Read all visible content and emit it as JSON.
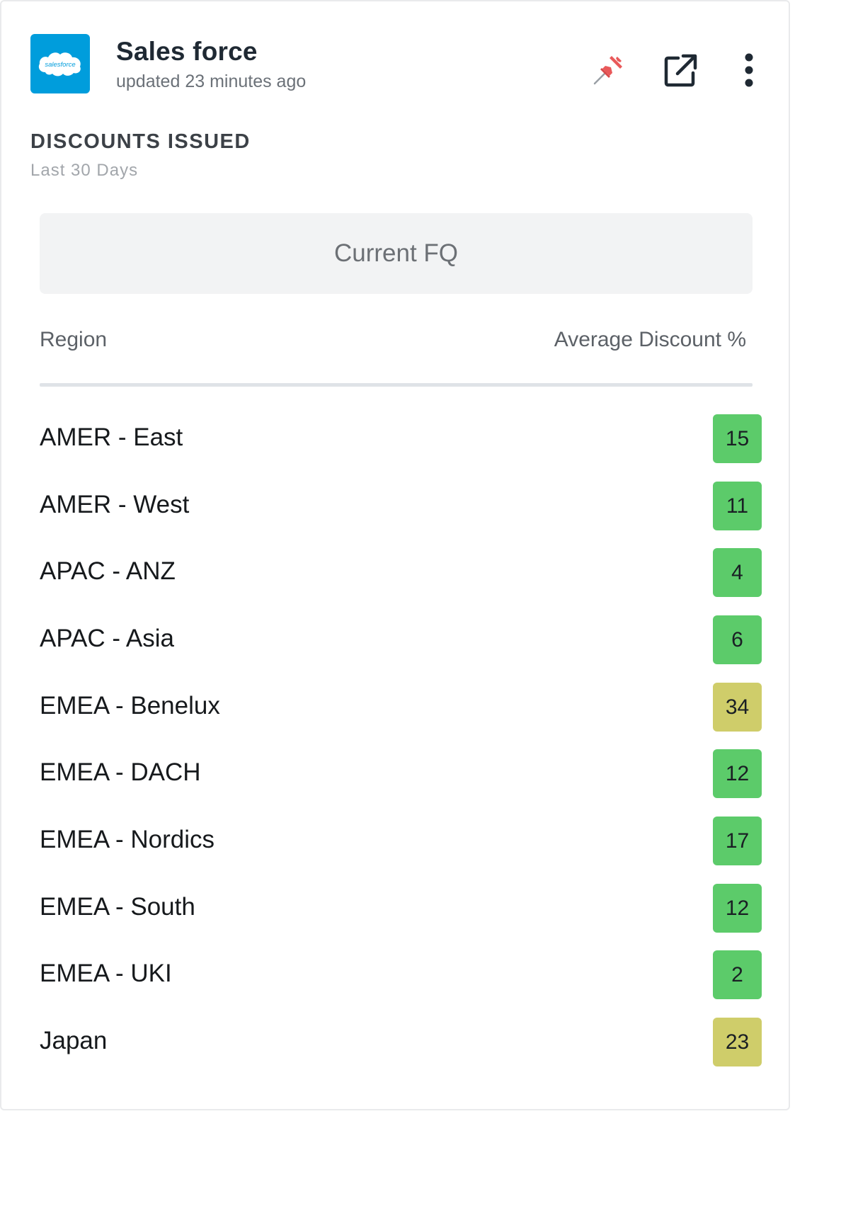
{
  "header": {
    "logo_text": "salesforce",
    "app_name": "Sales force",
    "updated": "updated 23 minutes ago",
    "logo_color": "#009ddc",
    "icons": [
      "pin-icon",
      "external-link-icon",
      "more-vertical-icon"
    ]
  },
  "widget": {
    "title": "DISCOUNTS ISSUED",
    "subtitle": "Last 30 Days",
    "period_label": "Current FQ"
  },
  "table": {
    "columns": [
      "Region",
      "Average Discount %"
    ],
    "rows": [
      {
        "region": "AMER - East",
        "value": "15",
        "status": "good"
      },
      {
        "region": "AMER - West",
        "value": "11",
        "status": "good"
      },
      {
        "region": "APAC - ANZ",
        "value": "4",
        "status": "good"
      },
      {
        "region": "APAC - Asia",
        "value": "6",
        "status": "good"
      },
      {
        "region": "EMEA - Benelux",
        "value": "34",
        "status": "warning"
      },
      {
        "region": "EMEA - DACH",
        "value": "12",
        "status": "good"
      },
      {
        "region": "EMEA - Nordics",
        "value": "17",
        "status": "good"
      },
      {
        "region": "EMEA - South",
        "value": "12",
        "status": "good"
      },
      {
        "region": "EMEA - UKI",
        "value": "2",
        "status": "good"
      },
      {
        "region": "Japan",
        "value": "23",
        "status": "warning"
      }
    ]
  },
  "colors": {
    "good": "#5ccb6a",
    "warning": "#cfcd6a",
    "accent_pin": "#e9595a"
  }
}
